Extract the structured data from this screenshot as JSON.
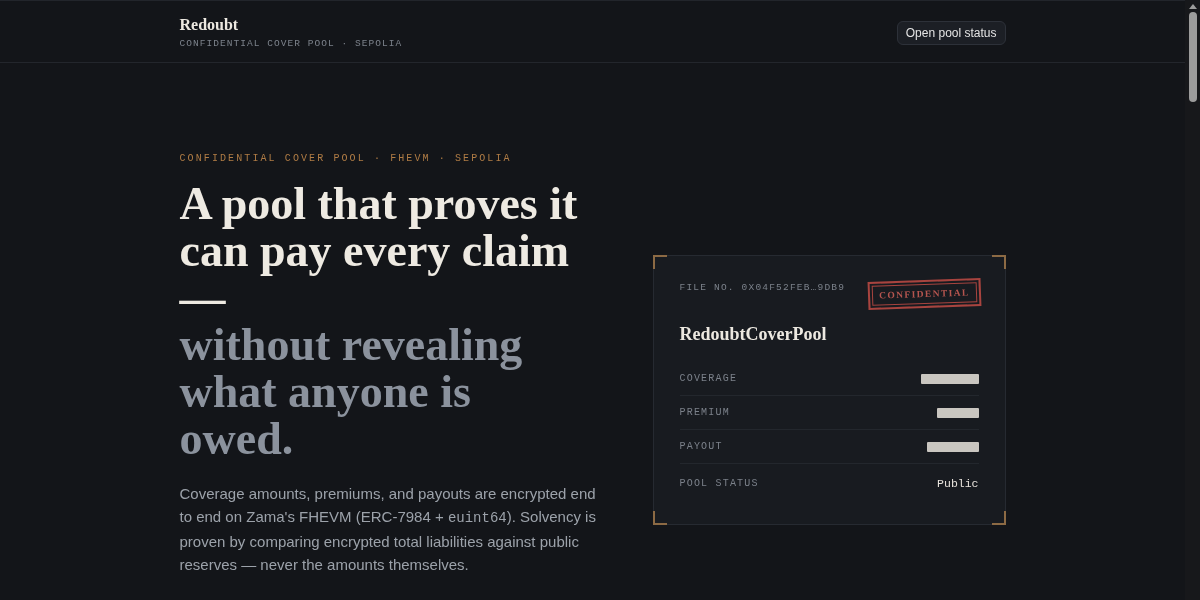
{
  "header": {
    "brand": "Redoubt",
    "subtitle": "CONFIDENTIAL COVER POOL · SEPOLIA",
    "button": "Open pool status"
  },
  "hero": {
    "eyebrow": "CONFIDENTIAL COVER POOL · FHEVM · SEPOLIA",
    "headline": "A pool that proves it can pay every claim —",
    "headline_muted": "without revealing what anyone is owed.",
    "description": [
      {
        "kind": "plain",
        "text": "Coverage amounts, premiums, and payouts are encrypted end to end on Zama's FHEVM (ERC-7984 + "
      },
      {
        "kind": "code",
        "text": "euint64"
      },
      {
        "kind": "plain",
        "text": "). Solvency is proven by comparing encrypted total liabilities against public reserves — never the amounts themselves."
      }
    ]
  },
  "card": {
    "file_no": "FILE NO. 0X04F52FEB…9DB9",
    "stamp": "CONFIDENTIAL",
    "title": "RedoubtCoverPool",
    "rows": [
      {
        "label": "COVERAGE",
        "kind": "redacted"
      },
      {
        "label": "PREMIUM",
        "kind": "redacted"
      },
      {
        "label": "PAYOUT",
        "kind": "redacted"
      },
      {
        "label": "POOL STATUS",
        "kind": "text",
        "value": "Public"
      }
    ]
  }
}
